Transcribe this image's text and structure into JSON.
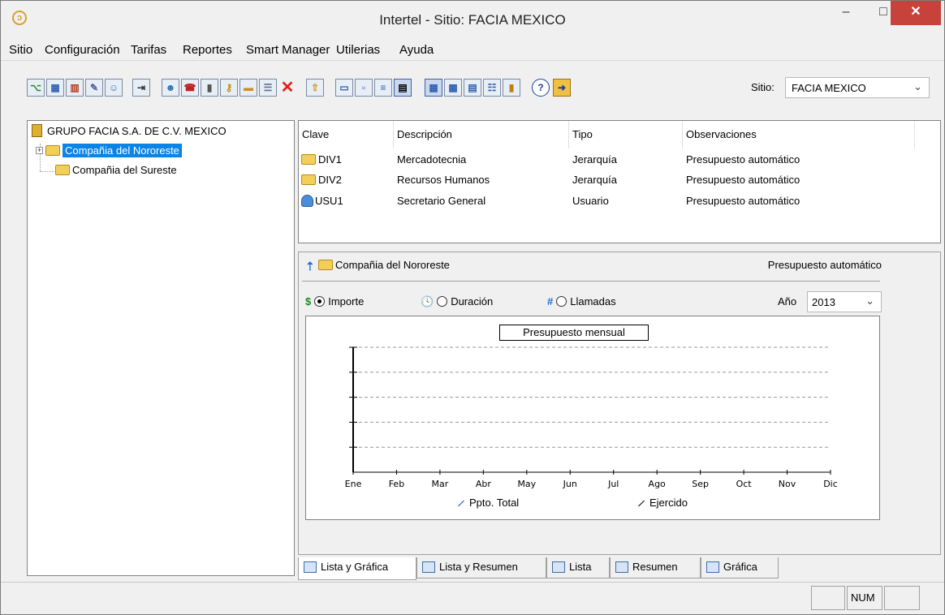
{
  "window": {
    "title": "Intertel - Sitio: FACIA MEXICO",
    "minimize": "–",
    "maximize": "□",
    "close": "✕",
    "accent": "#c7423a"
  },
  "menu": [
    "Sitio",
    "Configuración",
    "Tarifas",
    "Reportes",
    "Smart Manager",
    "Utilerias",
    "Ayuda"
  ],
  "toolbar": {
    "icons": [
      "tree-icon",
      "calendar-icon",
      "report-icon",
      "edit-icon",
      "users-icon",
      "import-icon",
      "add-user-icon",
      "phone-icon",
      "device-icon",
      "key-icon",
      "new-folder-icon",
      "properties-icon",
      "delete-icon",
      "up-level-icon",
      "large-icons-icon",
      "small-icons-icon",
      "list-view-icon",
      "details-view-icon",
      "list-chart-icon",
      "list-summary-icon",
      "list-icon",
      "summary-icon",
      "chart-icon",
      "help-icon",
      "exit-icon"
    ],
    "sitio_label": "Sitio:",
    "sitio_value": "FACIA MEXICO"
  },
  "tree": {
    "root": "GRUPO FACIA S.A. DE C.V. MEXICO",
    "children": [
      {
        "label": "Compañia del Nororeste",
        "selected": true,
        "expandable": true
      },
      {
        "label": "Compañia del Sureste",
        "selected": false,
        "expandable": false
      }
    ]
  },
  "list": {
    "columns": [
      "Clave",
      "Descripción",
      "Tipo",
      "Observaciones"
    ],
    "rows": [
      {
        "icon": "folder-icon",
        "clave": "DIV1",
        "descripcion": "Mercadotecnia",
        "tipo": "Jerarquía",
        "observaciones": "Presupuesto automático"
      },
      {
        "icon": "folder-icon",
        "clave": "DIV2",
        "descripcion": "Recursos Humanos",
        "tipo": "Jerarquía",
        "observaciones": "Presupuesto automático"
      },
      {
        "icon": "user-icon",
        "clave": "USU1",
        "descripcion": "Secretario General",
        "tipo": "Usuario",
        "observaciones": "Presupuesto automático"
      }
    ]
  },
  "detail": {
    "name": "Compañia del Nororeste",
    "note": "Presupuesto automático",
    "options": [
      {
        "symbol": "$",
        "label": "Importe",
        "checked": true,
        "color": "#1a8a1a"
      },
      {
        "symbol": "🕓",
        "label": "Duración",
        "checked": false,
        "color": "#1a6ed8"
      },
      {
        "symbol": "#",
        "label": "Llamadas",
        "checked": false,
        "color": "#1a6ed8"
      }
    ],
    "anio_label": "Año",
    "anio_value": "2013"
  },
  "chart_data": {
    "type": "line",
    "title": "Presupuesto mensual",
    "categories": [
      "Ene",
      "Feb",
      "Mar",
      "Abr",
      "May",
      "Jun",
      "Jul",
      "Ago",
      "Sep",
      "Oct",
      "Nov",
      "Dic"
    ],
    "series": [
      {
        "name": "Ppto. Total",
        "color": "#2244cc",
        "values": []
      },
      {
        "name": "Ejercido",
        "color": "#000000",
        "values": []
      }
    ],
    "grid": true,
    "legend": "bottom"
  },
  "tabs": [
    "Lista y Gráfica",
    "Lista y Resumen",
    "Lista",
    "Resumen",
    "Gráfica"
  ],
  "status": {
    "num": "NUM"
  }
}
